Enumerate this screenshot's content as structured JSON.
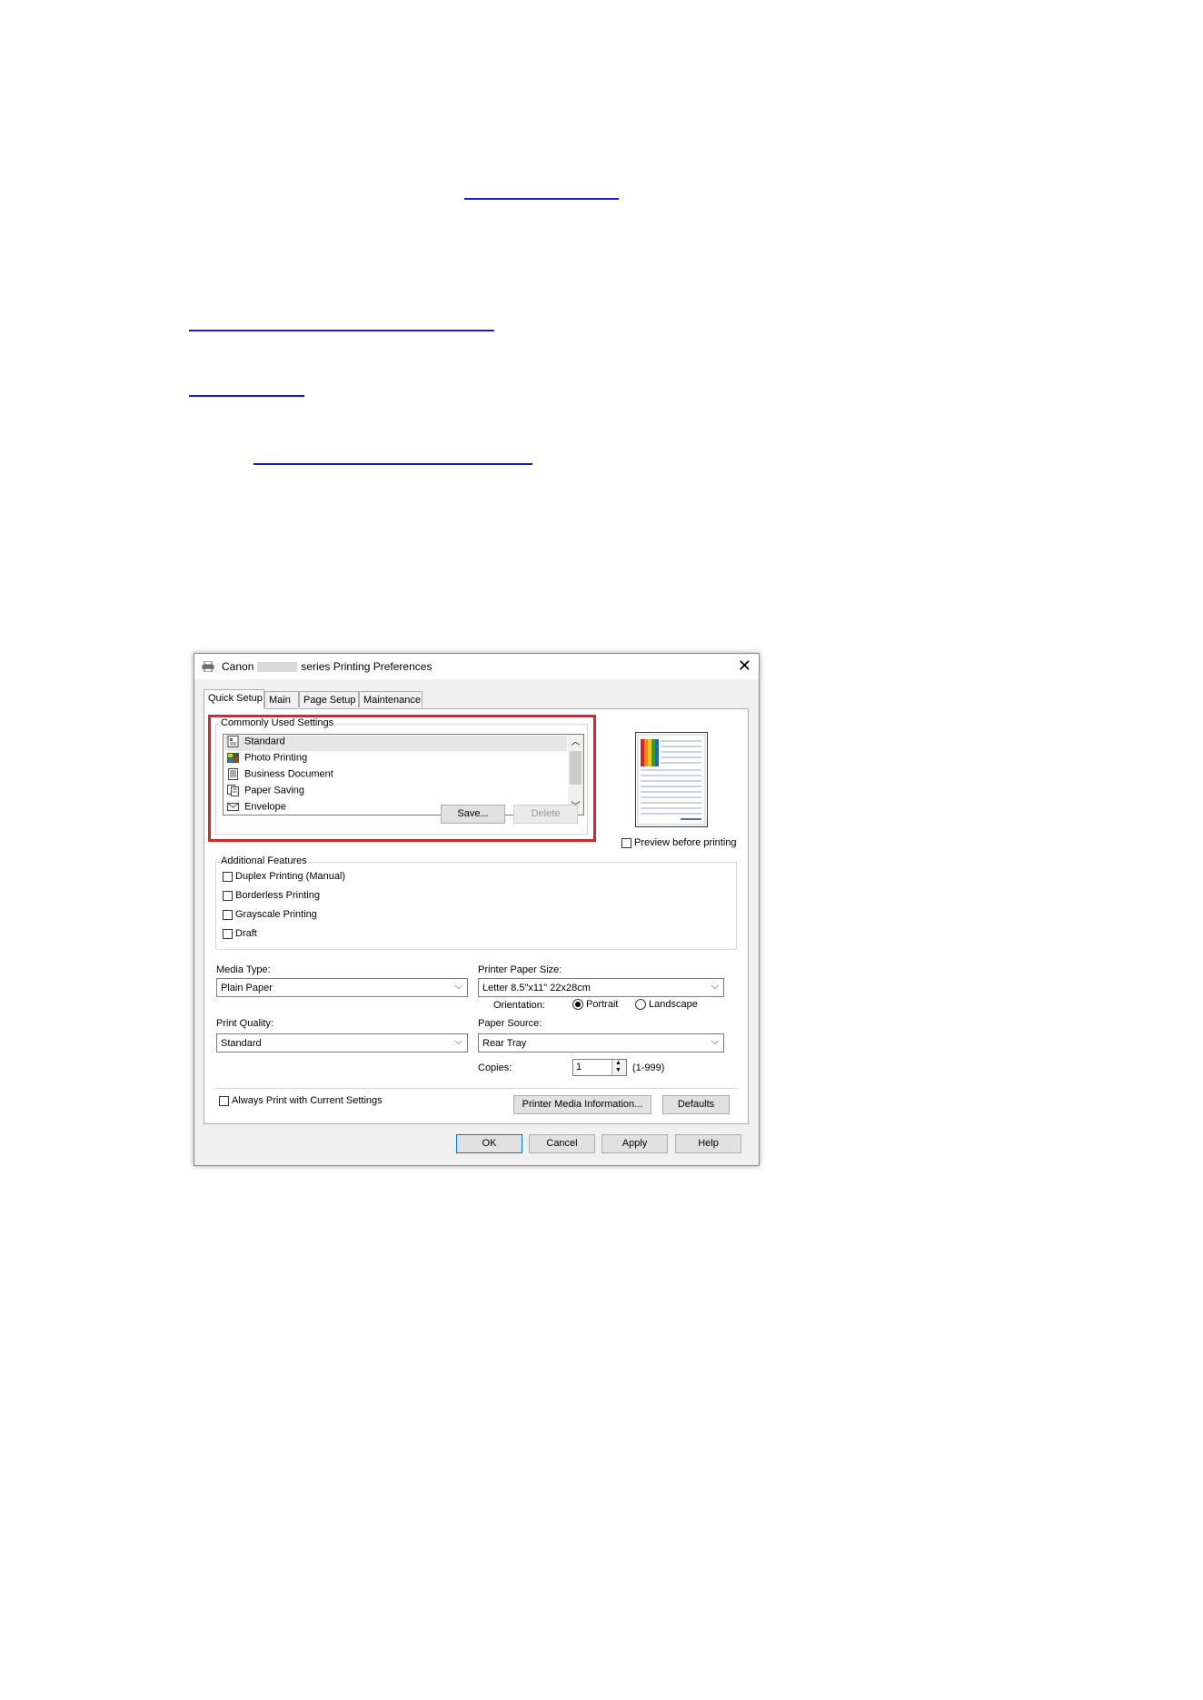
{
  "dialog": {
    "title_prefix": "Canon",
    "title_suffix": "series Printing Preferences",
    "close_glyph": "✕",
    "tabs": [
      {
        "label": "Quick Setup",
        "active": true
      },
      {
        "label": "Main",
        "active": false
      },
      {
        "label": "Page Setup",
        "active": false
      },
      {
        "label": "Maintenance",
        "active": false
      }
    ],
    "commonly_used": {
      "label": "Commonly Used Settings",
      "items": [
        {
          "label": "Standard",
          "icon": "standard-icon",
          "selected": true
        },
        {
          "label": "Photo Printing",
          "icon": "photo-icon",
          "selected": false
        },
        {
          "label": "Business Document",
          "icon": "document-icon",
          "selected": false
        },
        {
          "label": "Paper Saving",
          "icon": "paper-saving-icon",
          "selected": false
        },
        {
          "label": "Envelope",
          "icon": "envelope-icon",
          "selected": false
        }
      ],
      "save_label": "Save...",
      "delete_label": "Delete"
    },
    "preview_before_printing": {
      "label": "Preview before printing",
      "checked": false
    },
    "additional_features": {
      "label": "Additional Features",
      "items": [
        {
          "label": "Duplex Printing (Manual)",
          "checked": false
        },
        {
          "label": "Borderless Printing",
          "checked": false
        },
        {
          "label": "Grayscale Printing",
          "checked": false
        },
        {
          "label": "Draft",
          "checked": false
        }
      ]
    },
    "media_type": {
      "label": "Media Type:",
      "value": "Plain Paper"
    },
    "printer_paper_size": {
      "label": "Printer Paper Size:",
      "value": "Letter 8.5\"x11\" 22x28cm"
    },
    "orientation": {
      "label": "Orientation:",
      "portrait": "Portrait",
      "landscape": "Landscape",
      "selected": "Portrait"
    },
    "print_quality": {
      "label": "Print Quality:",
      "value": "Standard"
    },
    "paper_source": {
      "label": "Paper Source:",
      "value": "Rear Tray"
    },
    "copies": {
      "label": "Copies:",
      "value": "1",
      "range": "(1-999)"
    },
    "always_print_current": {
      "label": "Always Print with Current Settings",
      "checked": false
    },
    "printer_media_info_label": "Printer Media Information...",
    "defaults_label": "Defaults",
    "footer": {
      "ok": "OK",
      "cancel": "Cancel",
      "apply": "Apply",
      "help": "Help"
    },
    "highlight_color": "#e0202a"
  }
}
